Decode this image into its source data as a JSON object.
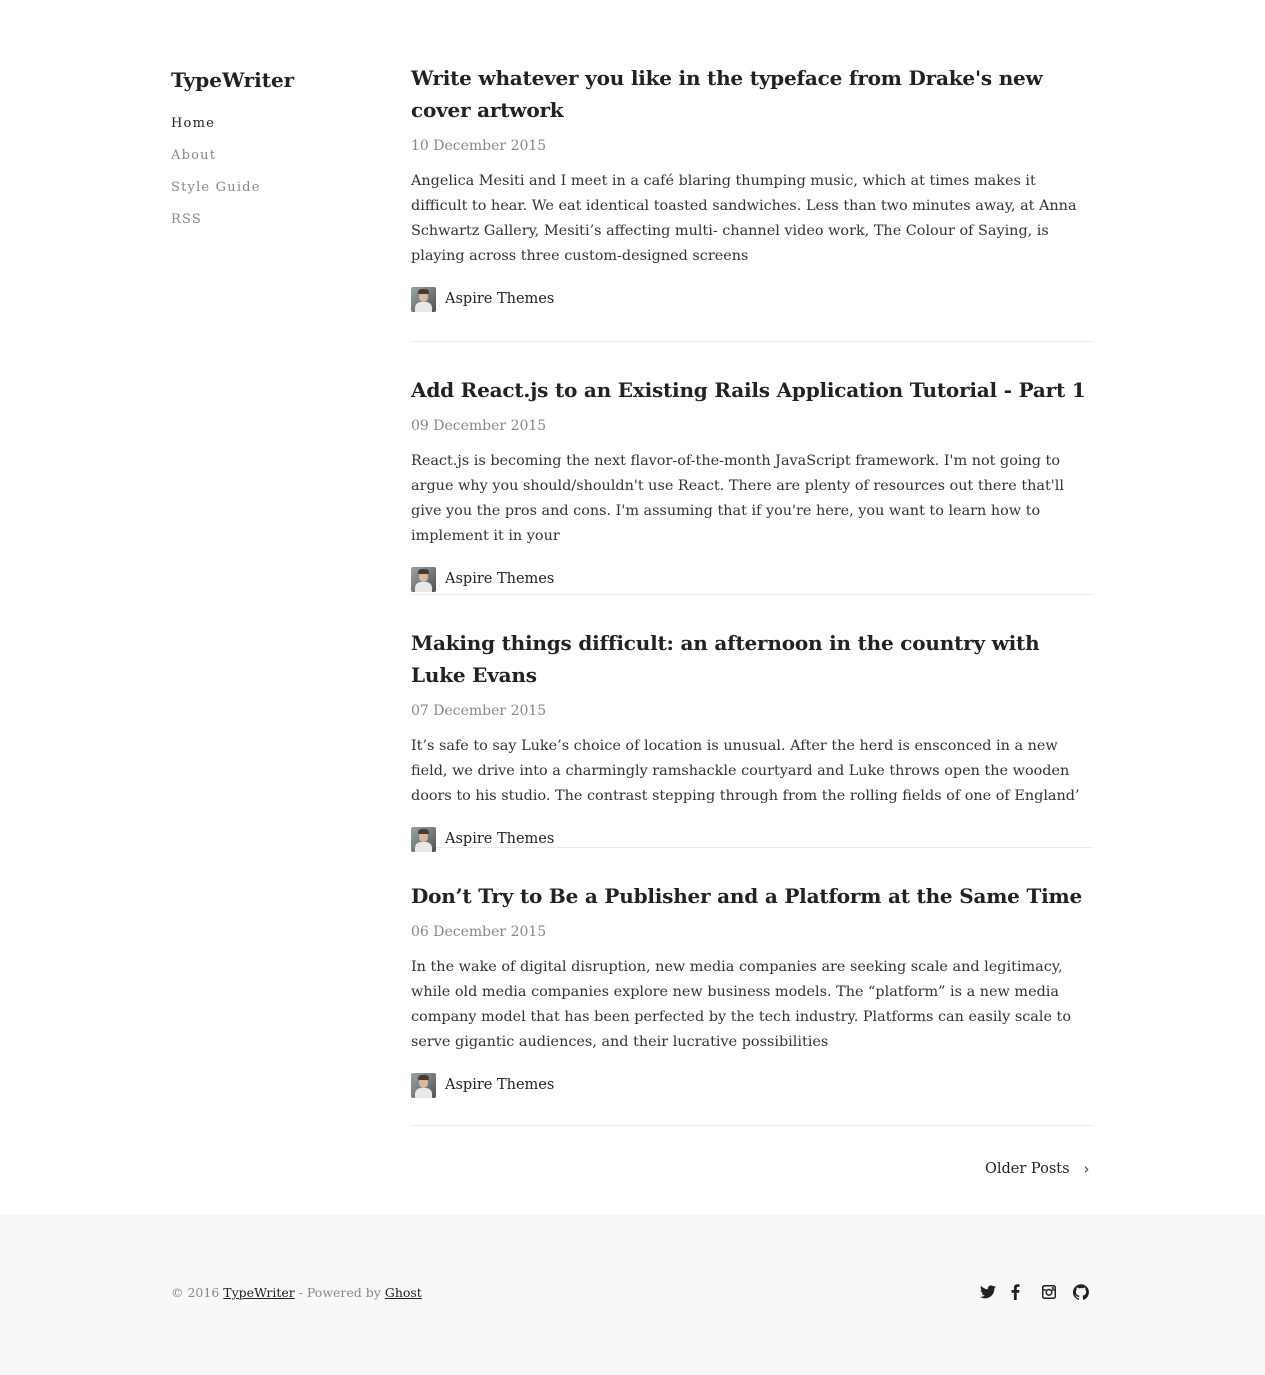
{
  "site": {
    "title": "TypeWriter"
  },
  "nav": {
    "items": [
      {
        "label": "Home"
      },
      {
        "label": "About"
      },
      {
        "label": "Style Guide"
      },
      {
        "label": "RSS"
      }
    ]
  },
  "posts": [
    {
      "title": "Write whatever you like in the typeface from Drake's new cover artwork",
      "date": "10 December 2015",
      "excerpt": "Angelica Mesiti and I meet in a café blaring thumping music, which at times makes it difficult to hear. We eat identical toasted sandwiches. Less than two minutes away, at Anna Schwartz Gallery, Mesiti’s affecting multi- channel video work, The Colour of Saying, is playing across three custom-designed screens",
      "author": "Aspire Themes"
    },
    {
      "title": "Add React.js to an Existing Rails Application Tutorial - Part 1",
      "date": "09 December 2015",
      "excerpt": "React.js is becoming the next flavor-of-the-month JavaScript framework. I'm not going to argue why you should/shouldn't use React. There are plenty of resources out there that'll give you the pros and cons. I'm assuming that if you're here, you want to learn how to implement it in your",
      "author": "Aspire Themes"
    },
    {
      "title": "Making things difficult: an afternoon in the country with Luke Evans",
      "date": "07 December 2015",
      "excerpt": "It’s safe to say Luke’s choice of location is unusual. After the herd is ensconced in a new field, we drive into a charmingly ramshackle courtyard and Luke throws open the wooden doors to his studio. The contrast stepping through from the rolling fields of one of England’",
      "author": "Aspire Themes"
    },
    {
      "title": "Don’t Try to Be a Publisher and a Platform at the Same Time",
      "date": "06 December 2015",
      "excerpt": "In the wake of digital disruption, new media companies are seeking scale and legitimacy, while old media companies explore new business models. The “platform” is a new media company model that has been perfected by the tech industry. Platforms can easily scale to serve gigantic audiences, and their lucrative possibilities",
      "author": "Aspire Themes"
    }
  ],
  "pagination": {
    "older_label": "Older Posts",
    "chevron": "›"
  },
  "footer": {
    "copyright_prefix": "© 2016 ",
    "site_link": "TypeWriter",
    "powered_text": " - Powered by ",
    "ghost_link": "Ghost",
    "social": [
      "twitter-icon",
      "facebook-icon",
      "instagram-icon",
      "github-icon"
    ]
  },
  "colors": {
    "text": "#222222",
    "muted": "#888888",
    "divider": "#ebebeb",
    "footer_bg": "#f8f8f8"
  }
}
